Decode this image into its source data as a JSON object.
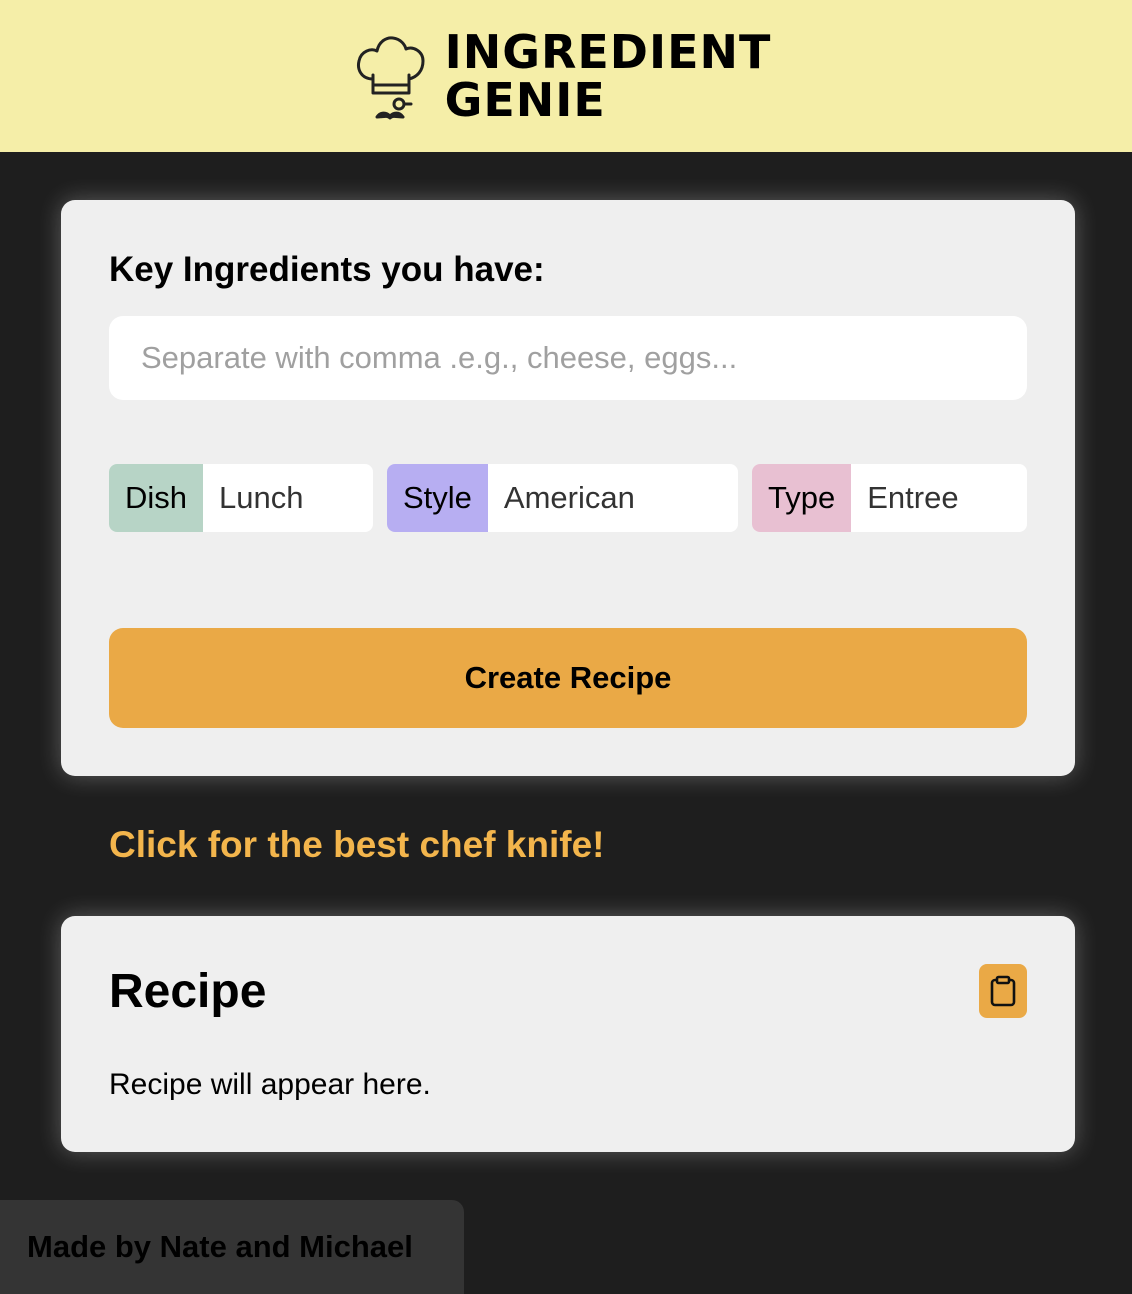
{
  "header": {
    "brand_line1": "INGREDIENT",
    "brand_line2": "GENIE",
    "logo_icon": "chef-hat-icon",
    "background": "#f5eea8"
  },
  "form": {
    "title": "Key Ingredients you have:",
    "ingredients_value": "",
    "ingredients_placeholder": "Separate with comma .e.g., cheese, eggs...",
    "dish": {
      "tag": "Dish",
      "value": "Lunch",
      "color": "#b7d4c6"
    },
    "style": {
      "tag": "Style",
      "value": "American",
      "color": "#b7aef2"
    },
    "type": {
      "tag": "Type",
      "value": "Entree",
      "color": "#e8c0d2"
    },
    "create_button": "Create Recipe",
    "accent": "#eaa946"
  },
  "promo": {
    "link_text": "Click for the best chef knife!",
    "color": "#f3b54c"
  },
  "recipe": {
    "title": "Recipe",
    "copy_icon": "clipboard-icon",
    "placeholder_text": "Recipe will appear here."
  },
  "footer": {
    "credit": "Made by Nate and Michael"
  }
}
